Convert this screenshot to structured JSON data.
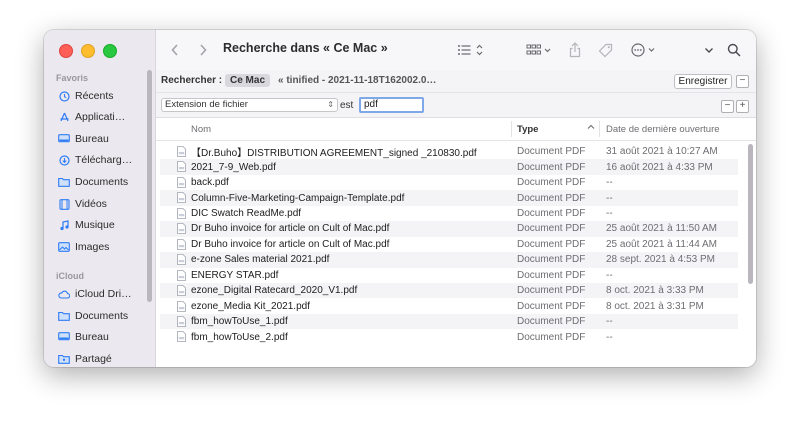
{
  "sidebar": {
    "favoris_header": "Favoris",
    "favoris": [
      {
        "label": "Récents",
        "icon": "clock-icon"
      },
      {
        "label": "Applicati…",
        "icon": "apps-icon"
      },
      {
        "label": "Bureau",
        "icon": "desktop-icon"
      },
      {
        "label": "Télécharg…",
        "icon": "download-icon"
      },
      {
        "label": "Documents",
        "icon": "folder-icon"
      },
      {
        "label": "Vidéos",
        "icon": "film-icon"
      },
      {
        "label": "Musique",
        "icon": "music-icon"
      },
      {
        "label": "Images",
        "icon": "photo-icon"
      }
    ],
    "icloud_header": "iCloud",
    "icloud": [
      {
        "label": "iCloud Dri…",
        "icon": "cloud-icon"
      },
      {
        "label": "Documents",
        "icon": "folder-icon"
      },
      {
        "label": "Bureau",
        "icon": "desktop-icon"
      },
      {
        "label": "Partagé",
        "icon": "shared-folder-icon"
      }
    ]
  },
  "toolbar": {
    "title": "Recherche dans « Ce Mac »"
  },
  "searchbar": {
    "label": "Rechercher :",
    "scope_active": "Ce Mac",
    "scope_other": "« tinified - 2021-11-18T162002.0…",
    "save_label": "Enregistrer",
    "minus": "−"
  },
  "criteria": {
    "attribute": "Extension de fichier",
    "operator": "est",
    "value": "pdf",
    "minus": "−",
    "plus": "+"
  },
  "columns": {
    "name": "Nom",
    "type": "Type",
    "date": "Date de dernière ouverture"
  },
  "rows": [
    {
      "name": "【Dr.Buho】DISTRIBUTION AGREEMENT_signed _210830.pdf",
      "type": "Document PDF",
      "date": "31 août 2021 à 10:27 AM"
    },
    {
      "name": "2021_7-9_Web.pdf",
      "type": "Document PDF",
      "date": "16 août 2021 à 4:33 PM"
    },
    {
      "name": "back.pdf",
      "type": "Document PDF",
      "date": "--"
    },
    {
      "name": "Column-Five-Marketing-Campaign-Template.pdf",
      "type": "Document PDF",
      "date": "--"
    },
    {
      "name": "DIC Swatch ReadMe.pdf",
      "type": "Document PDF",
      "date": "--"
    },
    {
      "name": "Dr Buho invoice for article on Cult of Mac.pdf",
      "type": "Document PDF",
      "date": "25 août 2021 à 11:50 AM"
    },
    {
      "name": "Dr Buho invoice for article on Cult of Mac.pdf",
      "type": "Document PDF",
      "date": "25 août 2021 à 11:44 AM"
    },
    {
      "name": "e-zone Sales material 2021.pdf",
      "type": "Document PDF",
      "date": "28 sept. 2021 à 4:53 PM"
    },
    {
      "name": "ENERGY STAR.pdf",
      "type": "Document PDF",
      "date": "--"
    },
    {
      "name": "ezone_Digital Ratecard_2020_V1.pdf",
      "type": "Document PDF",
      "date": "8 oct. 2021 à 3:33 PM"
    },
    {
      "name": "ezone_Media Kit_2021.pdf",
      "type": "Document PDF",
      "date": "8 oct. 2021 à 3:31 PM"
    },
    {
      "name": "fbm_howToUse_1.pdf",
      "type": "Document PDF",
      "date": "--"
    },
    {
      "name": "fbm_howToUse_2.pdf",
      "type": "Document PDF",
      "date": "--"
    }
  ]
}
